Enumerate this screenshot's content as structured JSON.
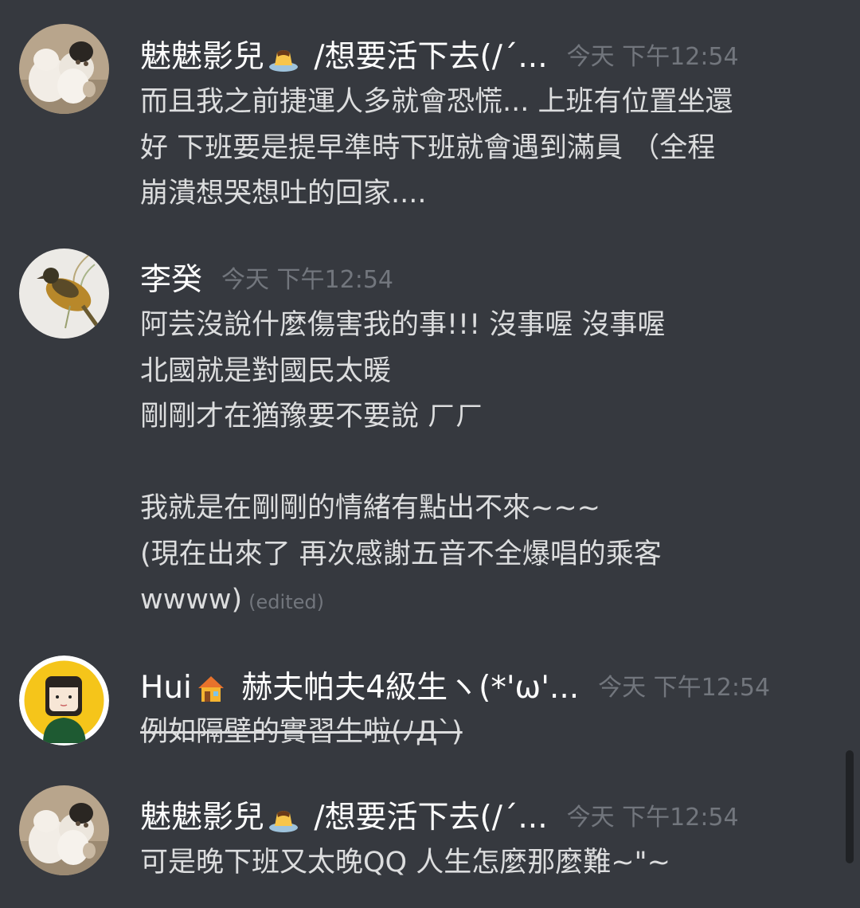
{
  "messages": [
    {
      "username": "魅魅影兒",
      "username_emoji": "pudding-icon",
      "username_suffix": " /想要活下去(/´...",
      "timestamp": "今天 下午12:54",
      "lines": [
        "而且我之前捷運人多就會恐慌... 上班有位置坐還",
        "好 下班要是提早準時下班就會遇到滿員 （全程",
        "崩潰想哭想吐的回家...."
      ]
    },
    {
      "username": "李癸",
      "timestamp": "今天 下午12:54",
      "lines": [
        "阿芸沒說什麼傷害我的事!!!  沒事喔  沒事喔",
        "北國就是對國民太暖",
        "剛剛才在猶豫要不要說  ㄏㄏ",
        "",
        "我就是在剛剛的情緒有點出不來~~~",
        "(現在出來了   再次感謝五音不全爆唱的乘客",
        "wwww)"
      ],
      "edited_label": "(edited)"
    },
    {
      "username": "Hui",
      "username_emoji": "house-icon",
      "username_suffix": " 赫夫帕夫4級生ヽ(*'ω'...",
      "timestamp": "今天 下午12:54",
      "lines": [
        "例如隔壁的實習生啦(ﾉДˋ)"
      ],
      "strikethrough": true
    },
    {
      "username": "魅魅影兒",
      "username_emoji": "pudding-icon",
      "username_suffix": " /想要活下去(/´...",
      "timestamp": "今天 下午12:54",
      "lines": [
        "可是晚下班又太晚QQ 人生怎麼那麼難~\"~"
      ]
    }
  ],
  "colors": {
    "background": "#36393f",
    "username": "#ffffff",
    "text": "#dcddde",
    "timestamp": "#72767d"
  }
}
